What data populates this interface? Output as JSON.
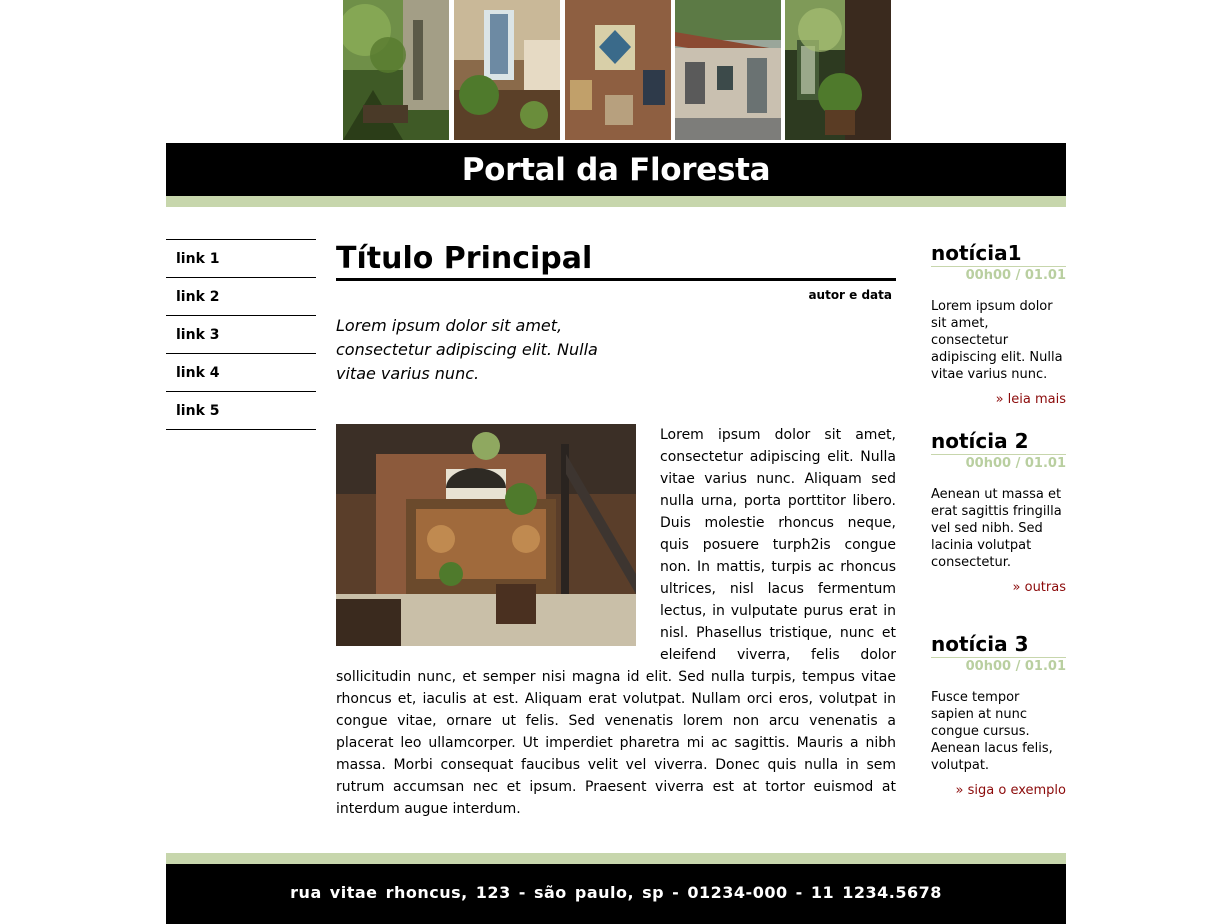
{
  "header": {
    "title": "Portal da Floresta"
  },
  "nav": {
    "links": [
      "link 1",
      "link 2",
      "link 3",
      "link 4",
      "link 5"
    ]
  },
  "article": {
    "title": "Título Principal",
    "author": "autor e data",
    "lead": "Lorem ipsum dolor sit amet, consectetur adipiscing elit. Nulla vitae varius nunc.",
    "body": "Lorem ipsum dolor sit amet, consectetur adipiscing elit. Nulla vitae varius nunc. Aliquam sed nulla urna, porta porttitor libero. Duis molestie rhoncus neque, quis posuere turph2is congue non. In mattis, turpis ac rhoncus ultrices, nisl lacus fermentum lectus, in vulputate purus erat in nisl. Phasellus tristique, nunc et eleifend viverra, felis dolor sollicitudin nunc, et semper nisi magna id elit. Sed nulla turpis, tempus vitae rhoncus et, iaculis at est. Aliquam erat volutpat. Nullam orci eros, volutpat in congue vitae, ornare ut felis. Sed venenatis lorem non arcu venenatis a placerat leo ullamcorper. Ut imperdiet pharetra mi ac sagittis. Mauris a nibh massa. Morbi consequat faucibus velit vel viverra. Donec quis nulla in sem rutrum accumsan nec et ipsum. Praesent viverra est at tortor euismod at interdum augue interdum."
  },
  "news": [
    {
      "title": "notícia1",
      "time": "00h00 / 01.01",
      "text": "Lorem ipsum dolor sit amet, consectetur adipiscing elit. Nulla vitae varius nunc.",
      "link": "» leia mais"
    },
    {
      "title": "notícia 2",
      "time": "00h00 / 01.01",
      "text": "Aenean ut massa et erat sagittis fringilla vel sed nibh. Sed lacinia volutpat consectetur.",
      "link": "» outras"
    },
    {
      "title": "notícia 3",
      "time": "00h00 / 01.01",
      "text": "Fusce tempor sapien at nunc congue cursus. Aenean lacus felis, volutpat.",
      "link": "» siga o exemplo"
    }
  ],
  "footer": {
    "address": "rua vitae rhoncus, 123 - são paulo, sp - 01234-000 - 11 1234.5678"
  },
  "colors": {
    "accent_green": "#c7d6ac",
    "link_red": "#8b0a0a",
    "header_bg": "#000000"
  }
}
